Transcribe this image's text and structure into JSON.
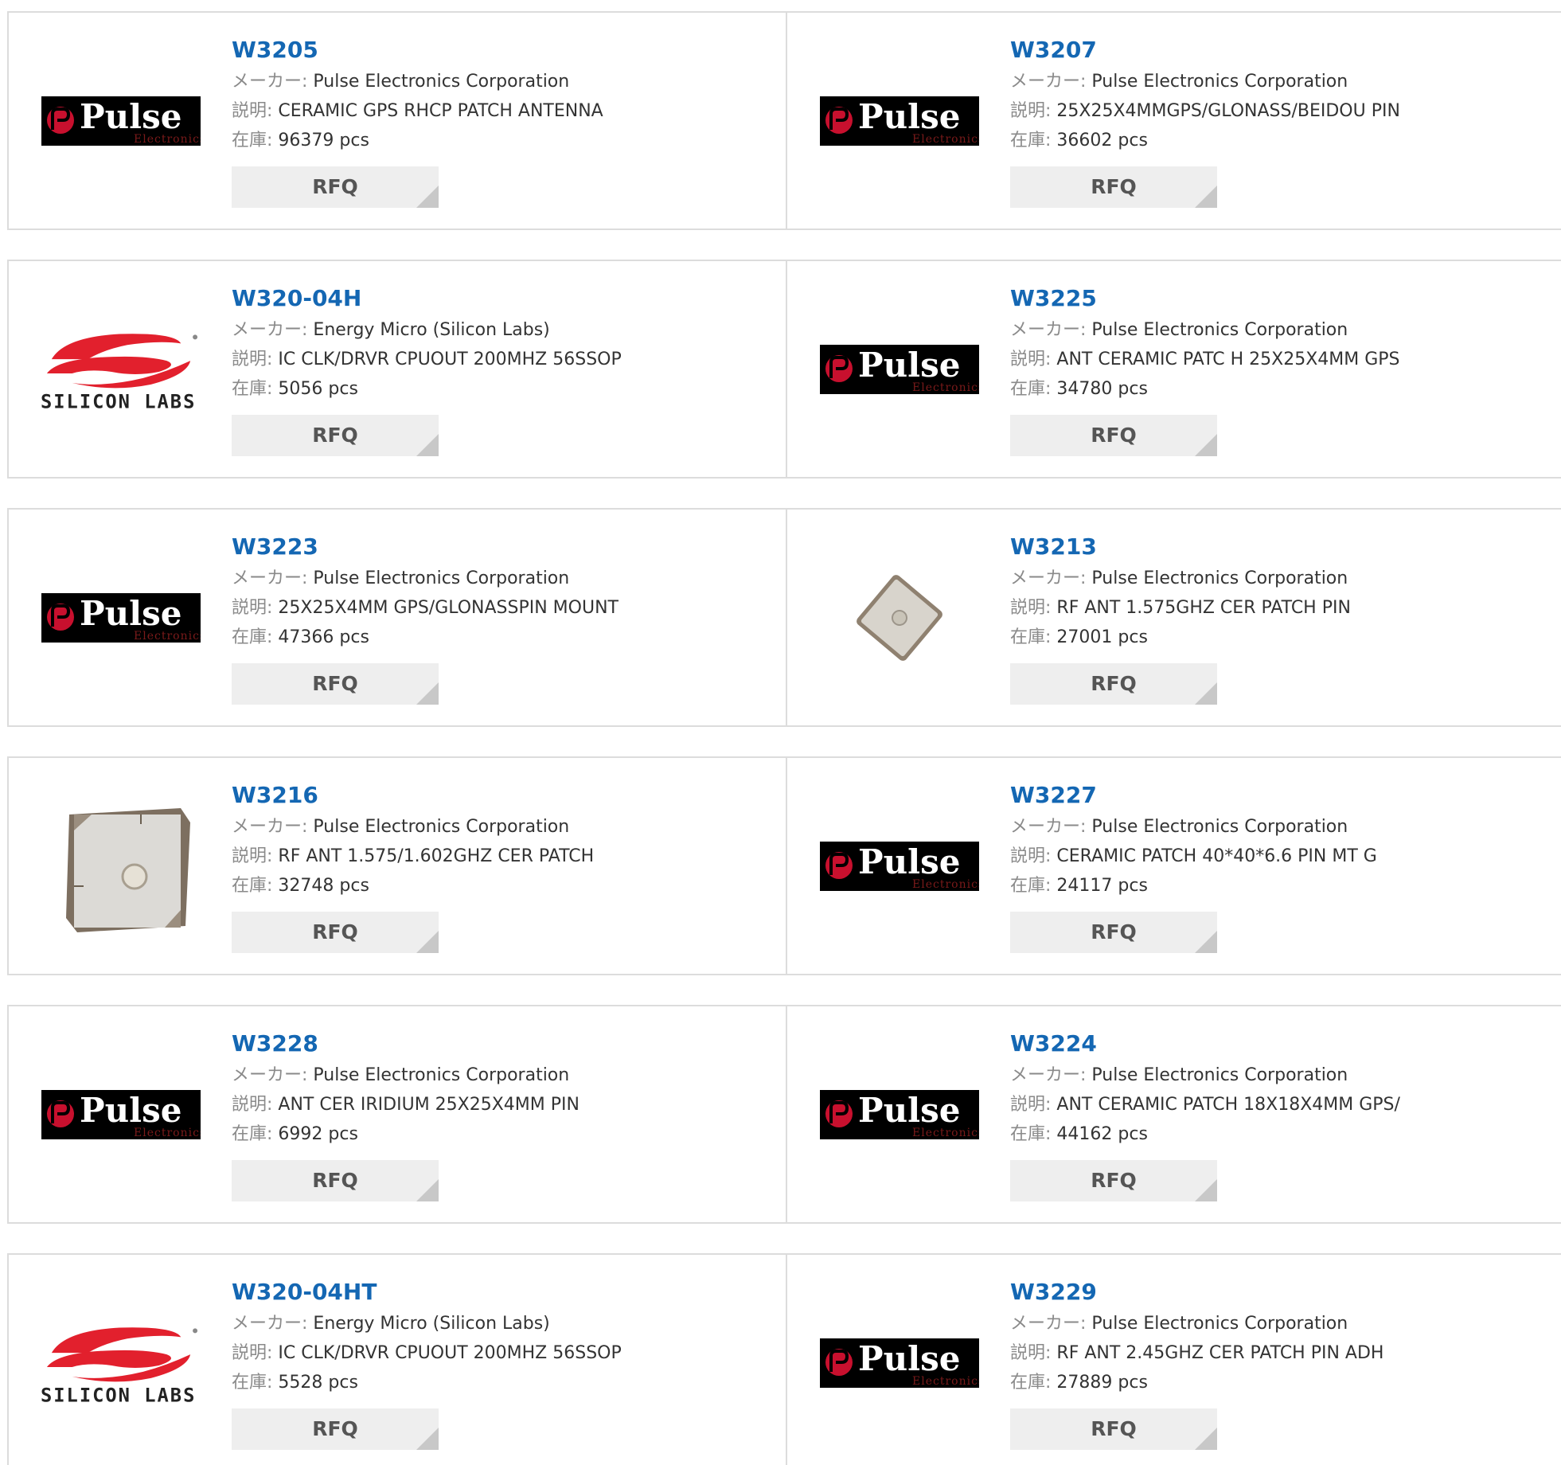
{
  "labels": {
    "maker": "メーカー:",
    "desc": "説明:",
    "stock": "在庫:"
  },
  "logos": {
    "pulse": {
      "word": "Pulse",
      "sub": "Electronics"
    },
    "silabs": {
      "word": "SILICON LABS"
    }
  },
  "products": [
    {
      "part": "W3205",
      "maker": "Pulse Electronics Corporation",
      "desc": "CERAMIC GPS RHCP PATCH ANTENNA",
      "stock": "96379 pcs",
      "rfq": "RFQ",
      "image": "pulse-logo"
    },
    {
      "part": "W3207",
      "maker": "Pulse Electronics Corporation",
      "desc": "25X25X4MMGPS/GLONASS/BEIDOU PIN",
      "stock": "36602 pcs",
      "rfq": "RFQ",
      "image": "pulse-logo"
    },
    {
      "part": "W320-04H",
      "maker": "Energy Micro (Silicon Labs)",
      "desc": "IC CLK/DRVR CPUOUT 200MHZ 56SSOP",
      "stock": "5056 pcs",
      "rfq": "RFQ",
      "image": "silicon-labs-logo"
    },
    {
      "part": "W3225",
      "maker": "Pulse Electronics Corporation",
      "desc": "ANT CERAMIC PATC H 25X25X4MM GPS",
      "stock": "34780 pcs",
      "rfq": "RFQ",
      "image": "pulse-logo"
    },
    {
      "part": "W3223",
      "maker": "Pulse Electronics Corporation",
      "desc": "25X25X4MM GPS/GLONASSPIN MOUNT",
      "stock": "47366 pcs",
      "rfq": "RFQ",
      "image": "pulse-logo"
    },
    {
      "part": "W3213",
      "maker": "Pulse Electronics Corporation",
      "desc": "RF ANT 1.575GHZ CER PATCH PIN",
      "stock": "27001 pcs",
      "rfq": "RFQ",
      "image": "patch-antenna-small"
    },
    {
      "part": "W3216",
      "maker": "Pulse Electronics Corporation",
      "desc": "RF ANT 1.575/1.602GHZ CER PATCH",
      "stock": "32748 pcs",
      "rfq": "RFQ",
      "image": "patch-antenna-large"
    },
    {
      "part": "W3227",
      "maker": "Pulse Electronics Corporation",
      "desc": "CERAMIC PATCH 40*40*6.6 PIN MT G",
      "stock": "24117 pcs",
      "rfq": "RFQ",
      "image": "pulse-logo"
    },
    {
      "part": "W3228",
      "maker": "Pulse Electronics Corporation",
      "desc": "ANT CER IRIDIUM 25X25X4MM PIN",
      "stock": "6992 pcs",
      "rfq": "RFQ",
      "image": "pulse-logo"
    },
    {
      "part": "W3224",
      "maker": "Pulse Electronics Corporation",
      "desc": "ANT CERAMIC PATCH 18X18X4MM GPS/",
      "stock": "44162 pcs",
      "rfq": "RFQ",
      "image": "pulse-logo"
    },
    {
      "part": "W320-04HT",
      "maker": "Energy Micro (Silicon Labs)",
      "desc": "IC CLK/DRVR CPUOUT 200MHZ 56SSOP",
      "stock": "5528 pcs",
      "rfq": "RFQ",
      "image": "silicon-labs-logo"
    },
    {
      "part": "W3229",
      "maker": "Pulse Electronics Corporation",
      "desc": "RF ANT 2.45GHZ CER PATCH PIN ADH",
      "stock": "27889 pcs",
      "rfq": "RFQ",
      "image": "pulse-logo"
    }
  ]
}
